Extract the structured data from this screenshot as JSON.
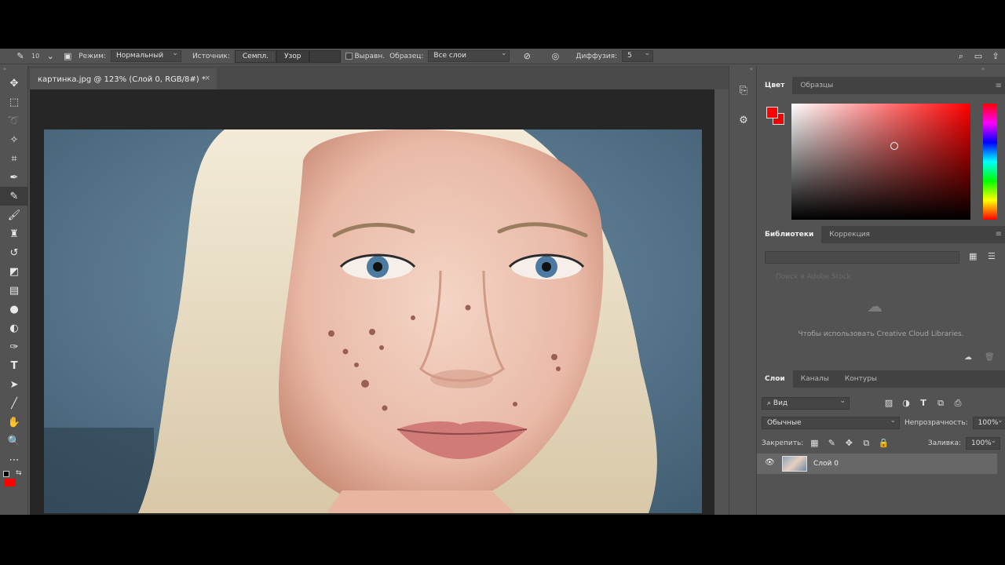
{
  "options_bar": {
    "brush_size": "10",
    "mode_label": "Режим:",
    "mode_value": "Нормальный",
    "source_label": "Источник:",
    "source_sampled": "Семпл.",
    "source_pattern": "Узор",
    "aligned_label": "Выравн.",
    "sample_label": "Образец:",
    "sample_value": "Все слои",
    "diffusion_label": "Диффузия:",
    "diffusion_value": "5"
  },
  "document_tab": {
    "title": "картинка.jpg @ 123% (Слой 0, RGB/8#) *",
    "close": "×"
  },
  "color_panel": {
    "tabs": [
      "Цвет",
      "Образцы"
    ],
    "foreground": "#ff0000",
    "background": "#e60000"
  },
  "libraries_panel": {
    "tabs": [
      "Библиотеки",
      "Коррекция"
    ],
    "search_placeholder": "Поиск в Adobe Stock",
    "message": "Чтобы использовать Creative Cloud Libraries."
  },
  "layers_panel": {
    "tabs": [
      "Слои",
      "Каналы",
      "Контуры"
    ],
    "filter_value": "Вид",
    "blend_mode": "Обычные",
    "opacity_label": "Непрозрачность:",
    "opacity_value": "100%",
    "lock_label": "Закрепить:",
    "fill_label": "Заливка:",
    "fill_value": "100%",
    "layers": [
      {
        "name": "Слой 0"
      }
    ]
  }
}
